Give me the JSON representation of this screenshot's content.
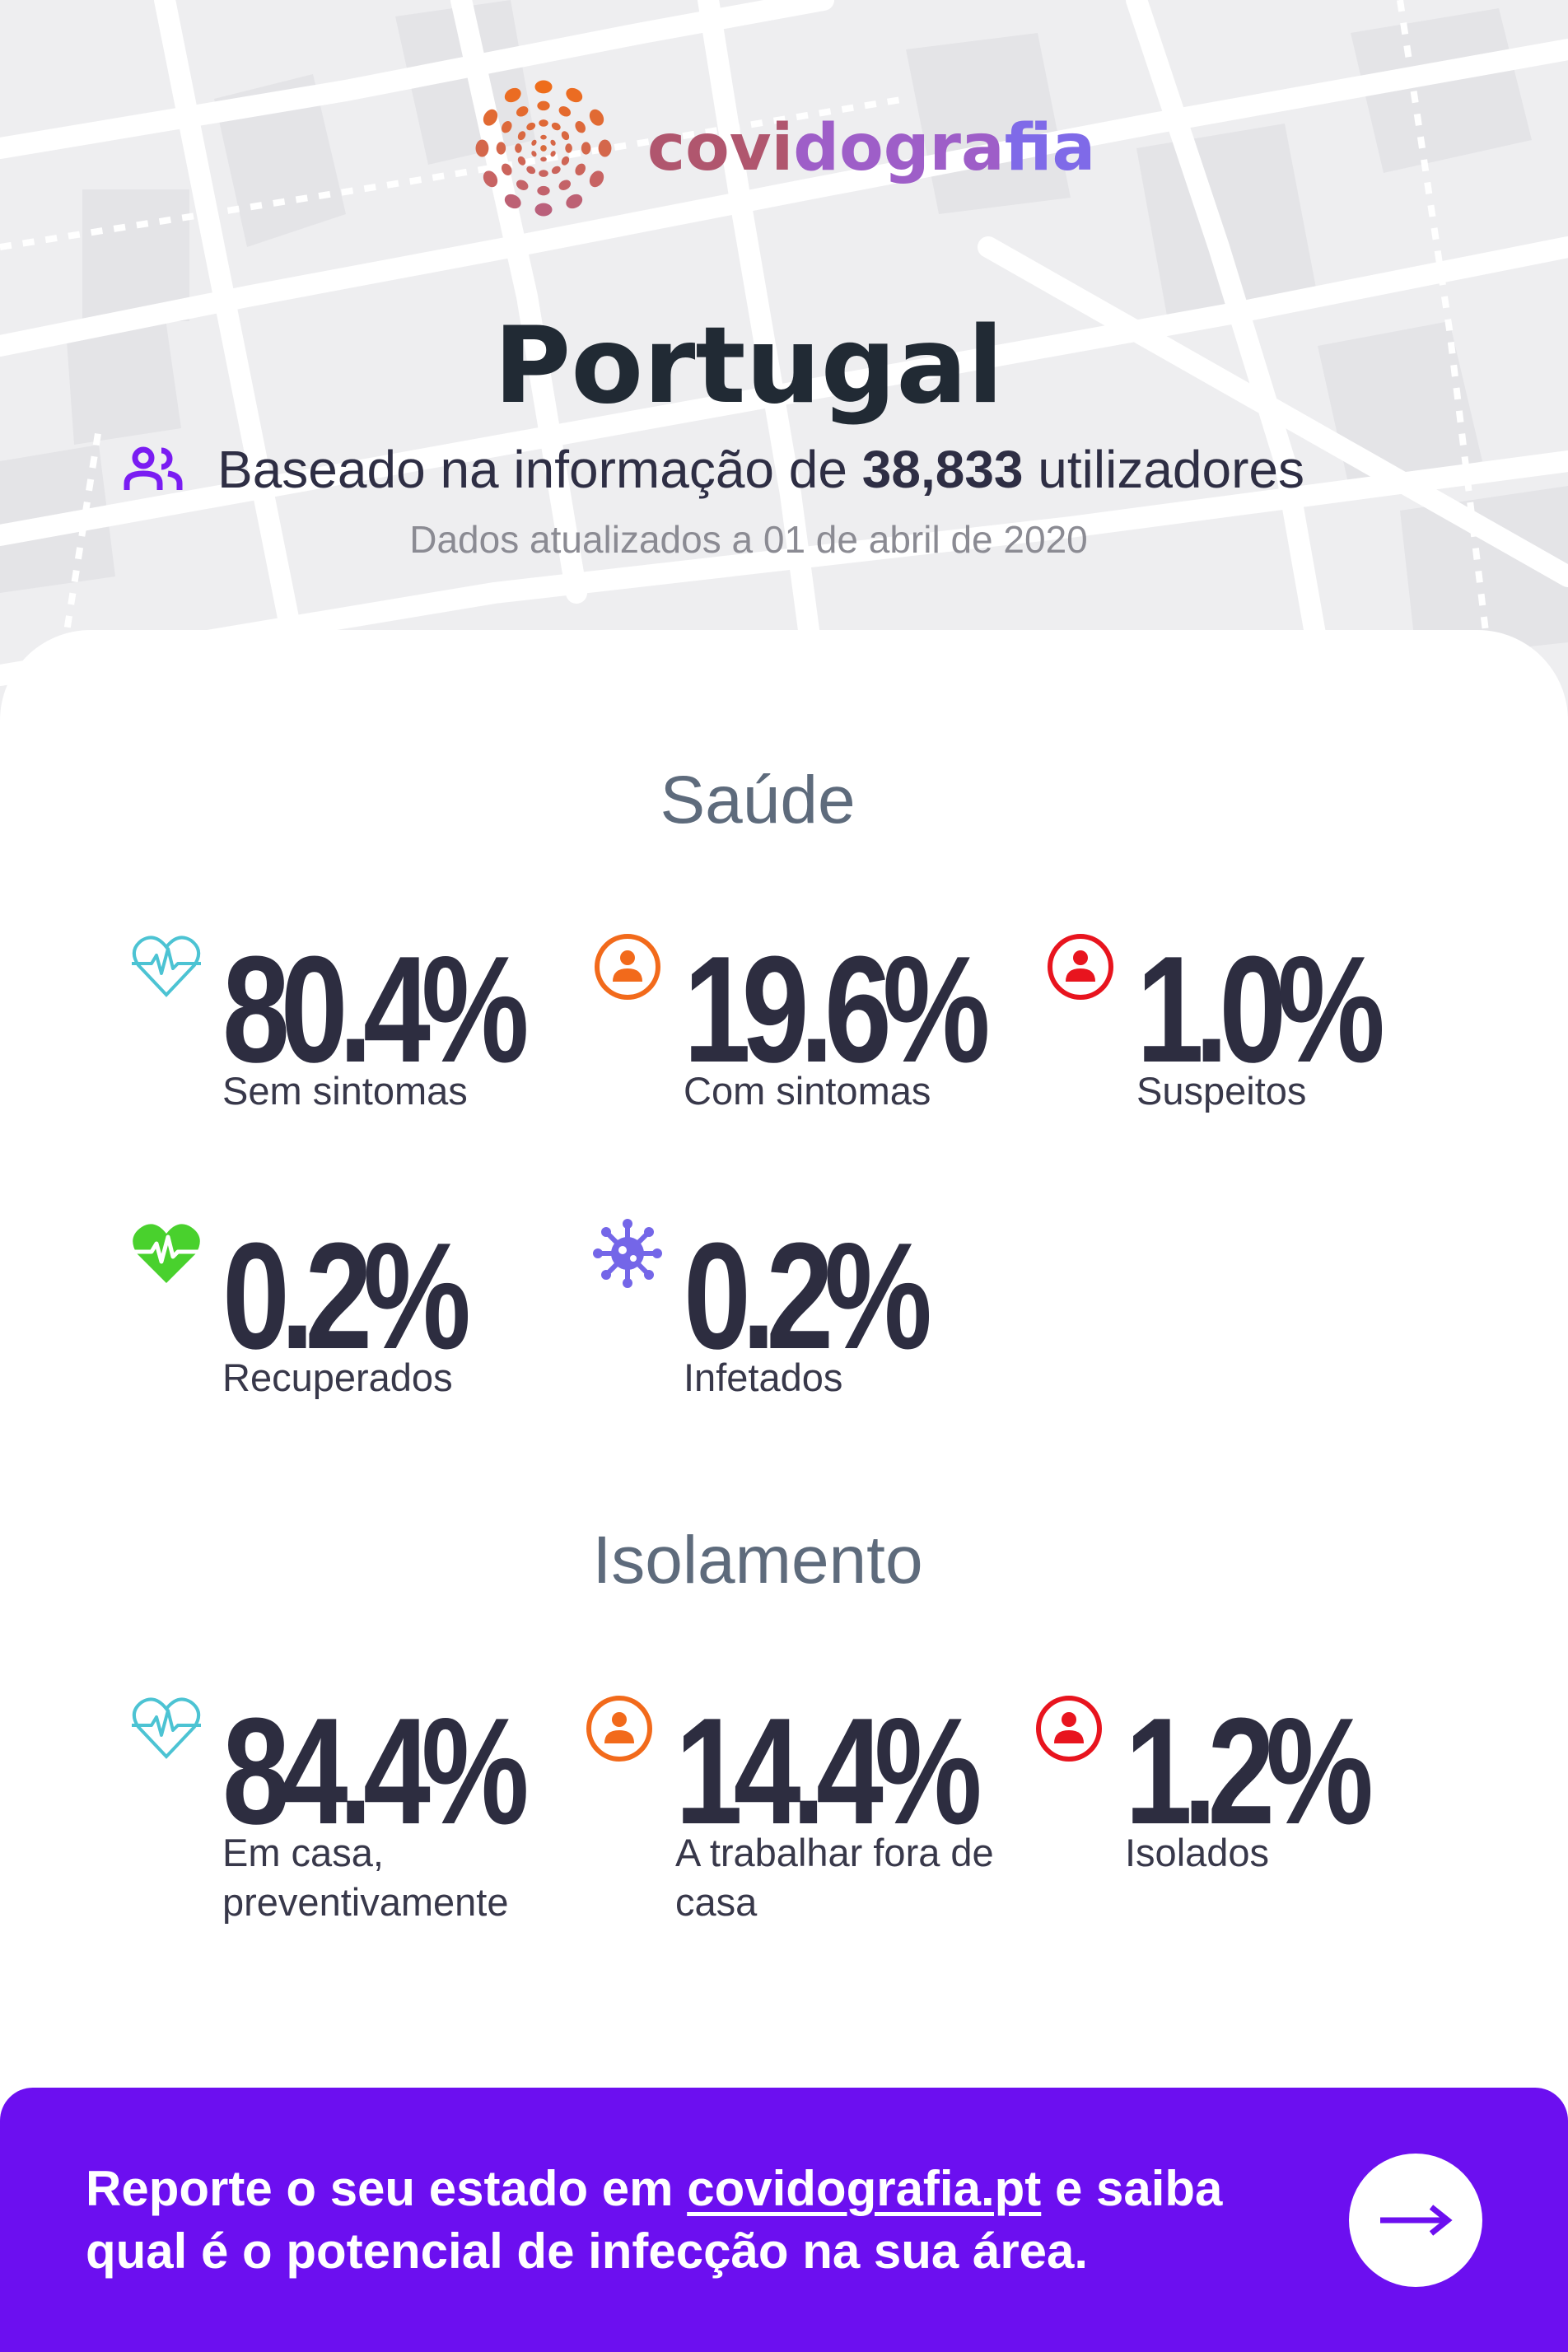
{
  "brand": {
    "name_part1": "covi",
    "name_part2": "dogra",
    "name_part3": "fia"
  },
  "header": {
    "country": "Portugal",
    "users_prefix": "Baseado na informação de",
    "users_count": "38,833",
    "users_suffix": "utilizadores",
    "updated": "Dados atualizados a 01 de abril de 2020"
  },
  "health": {
    "title": "Saúde",
    "stats": [
      {
        "value": "80.4%",
        "label": "Sem sintomas",
        "icon": "heartbeat-outline-icon",
        "color": "#4cc3d3"
      },
      {
        "value": "19.6%",
        "label": "Com sintomas",
        "icon": "person-circle-icon",
        "color": "#f26a1b"
      },
      {
        "value": "1.0%",
        "label": "Suspeitos",
        "icon": "person-circle-icon",
        "color": "#e8141e"
      },
      {
        "value": "0.2%",
        "label": "Recuperados",
        "icon": "heart-filled-icon",
        "color": "#49d12d"
      },
      {
        "value": "0.2%",
        "label": "Infetados",
        "icon": "virus-icon",
        "color": "#7466e8"
      }
    ]
  },
  "isolation": {
    "title": "Isolamento",
    "stats": [
      {
        "value": "84.4%",
        "label": "Em casa, preventivamente",
        "icon": "heartbeat-outline-icon",
        "color": "#4cc3d3"
      },
      {
        "value": "14.4%",
        "label": "A trabalhar fora de casa",
        "icon": "person-circle-icon",
        "color": "#f26a1b"
      },
      {
        "value": "1.2%",
        "label": "Isolados",
        "icon": "person-circle-icon",
        "color": "#e8141e"
      }
    ]
  },
  "banner": {
    "text_before": "Reporte o seu estado em",
    "link": "covidografia.pt",
    "text_after": "e saiba qual é o potencial de infecção na sua área.",
    "background": "#6c0ff0"
  }
}
